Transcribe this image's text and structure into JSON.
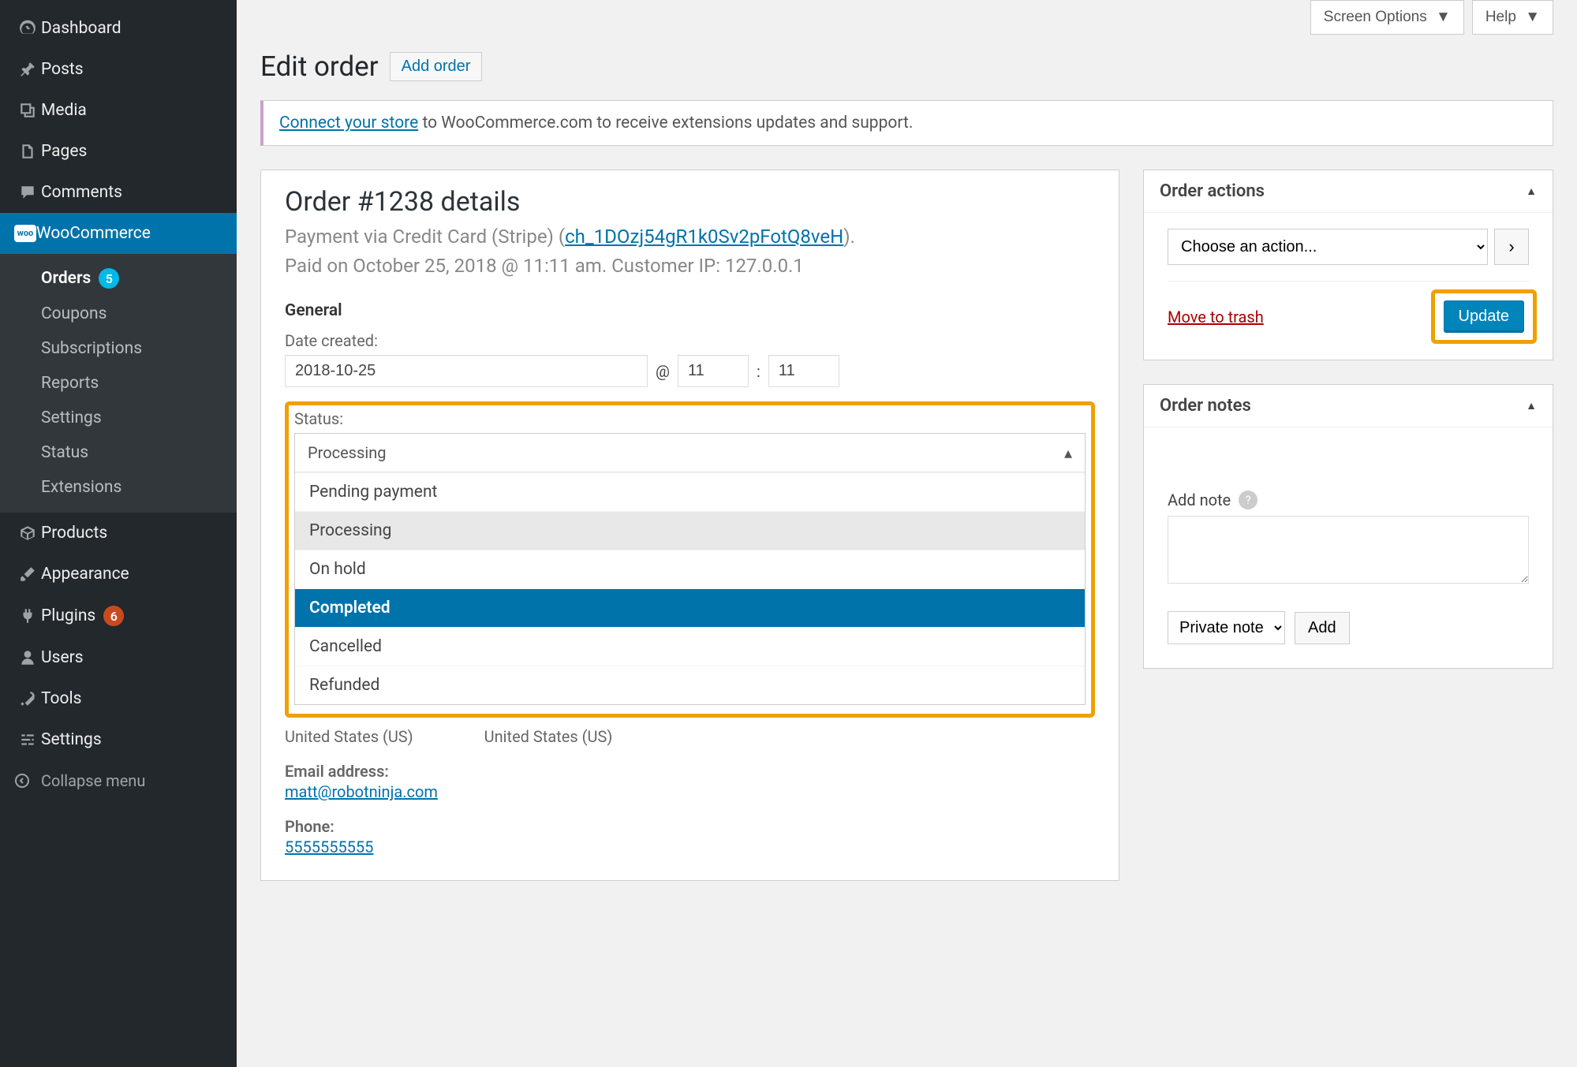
{
  "screen_options": {
    "screen_opts": "Screen Options",
    "help": "Help"
  },
  "sidebar": {
    "items": [
      {
        "label": "Dashboard"
      },
      {
        "label": "Posts"
      },
      {
        "label": "Media"
      },
      {
        "label": "Pages"
      },
      {
        "label": "Comments"
      },
      {
        "label": "WooCommerce"
      },
      {
        "label": "Products"
      },
      {
        "label": "Appearance"
      },
      {
        "label": "Plugins",
        "badge": "6"
      },
      {
        "label": "Users"
      },
      {
        "label": "Tools"
      },
      {
        "label": "Settings"
      }
    ],
    "sub": [
      {
        "label": "Orders",
        "badge": "5"
      },
      {
        "label": "Coupons"
      },
      {
        "label": "Subscriptions"
      },
      {
        "label": "Reports"
      },
      {
        "label": "Settings"
      },
      {
        "label": "Status"
      },
      {
        "label": "Extensions"
      }
    ],
    "collapse": "Collapse menu"
  },
  "heading": {
    "title": "Edit order",
    "add": "Add order"
  },
  "notice": {
    "link": "Connect your store",
    "text": " to WooCommerce.com to receive extensions updates and support."
  },
  "order": {
    "title": "Order #1238 details",
    "payment_prefix": "Payment via Credit Card (Stripe) (",
    "payment_link": "ch_1DOzj54gR1k0Sv2pFotQ8veH",
    "payment_suffix": ").",
    "paid": "Paid on October 25, 2018 @ 11:11 am. Customer IP: 127.0.0.1"
  },
  "general": {
    "heading": "General",
    "date_label": "Date created:",
    "date": "2018-10-25",
    "at": "@",
    "hour": "11",
    "colon": ":",
    "minute": "11",
    "status_label": "Status:",
    "status_selected": "Processing",
    "status_options": [
      "Pending payment",
      "Processing",
      "On hold",
      "Completed",
      "Cancelled",
      "Refunded"
    ],
    "country_left": "United States (US)",
    "country_right": "United States (US)",
    "email_label": "Email address:",
    "email": "matt@robotninja.com",
    "phone_label": "Phone:",
    "phone": "5555555555"
  },
  "actions": {
    "title": "Order actions",
    "choose": "Choose an action...",
    "arrow": "›",
    "trash": "Move to trash",
    "update": "Update"
  },
  "notes": {
    "title": "Order notes",
    "add_label": "Add note",
    "private": "Private note",
    "add_btn": "Add"
  }
}
